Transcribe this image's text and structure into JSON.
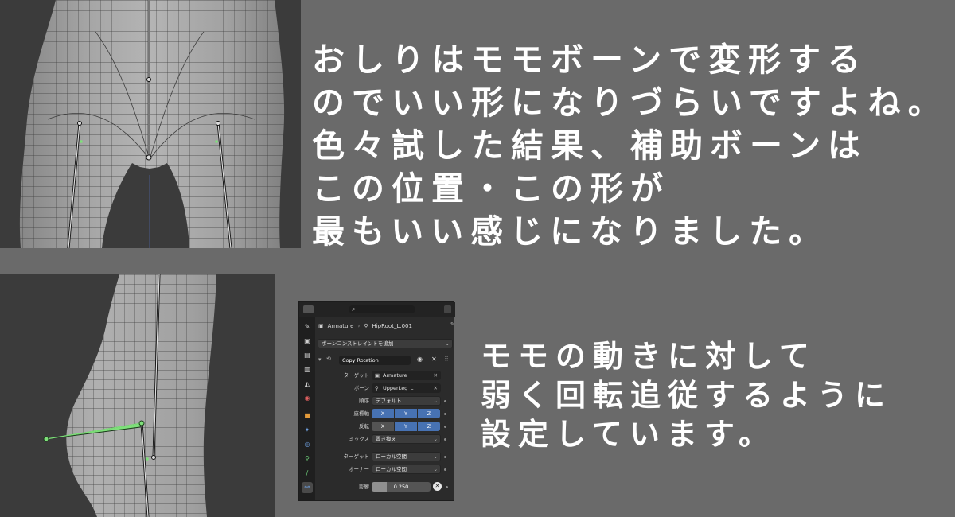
{
  "captions": {
    "top": [
      "おしりはモモボーンで変形する",
      "のでいい形になりづらいですよね。",
      "色々試した結果、補助ボーンは",
      "この位置・この形が",
      "最もいい感じになりました。"
    ],
    "bottom": [
      "モモの動きに対して",
      "弱く回転追従するように",
      "設定しています。"
    ]
  },
  "panel": {
    "breadcrumb": {
      "object": "Armature",
      "bone": "HipRoot_L.001"
    },
    "add_constraint_label": "ボーンコンストレイントを追加",
    "constraint_name": "Copy Rotation",
    "target_label": "ターゲット",
    "target_value": "Armature",
    "bone_label": "ボーン",
    "bone_value": "UpperLeg_L",
    "order_label": "順序",
    "order_value": "デフォルト",
    "axis_label": "座標軸",
    "invert_label": "反転",
    "axes": [
      "X",
      "Y",
      "Z"
    ],
    "axis_enabled": [
      true,
      true,
      true
    ],
    "invert_enabled": [
      false,
      true,
      true
    ],
    "mix_label": "ミックス",
    "mix_value": "置き換え",
    "target_space_label": "ターゲット",
    "target_space_value": "ローカル空間",
    "owner_space_label": "オーナー",
    "owner_space_value": "ローカル空間",
    "influence_label": "影響",
    "influence_value": "0.250",
    "influence_fraction": 0.25
  },
  "icons": {
    "search": "search-icon",
    "pin": "pin-icon",
    "eye": "eye-icon",
    "close": "close-icon"
  },
  "colors": {
    "background": "#6a6a6a",
    "accent_axis": "#4772b3",
    "bone_selected": "#7ee07a"
  }
}
